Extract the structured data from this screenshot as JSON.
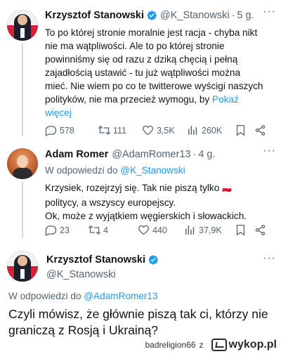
{
  "tweet1": {
    "name": "Krzysztof Stanowski",
    "handle": "@K_Stanowski",
    "time": "5 g.",
    "lines": [
      "To po której stronie moralnie jest racja - chyba nikt",
      "nie ma wątpliwości. Ale to po której stronie",
      "powinniśmy się od razu z dziką chęcią i pełną",
      "zajadłością ustawić - tu już wątpliwości można",
      "mieć. Nie wiem po co te twitterowe wyścigi naszych",
      "polityków, nie ma przecież wymogu, by"
    ],
    "show_more_a": "Pokaż",
    "show_more_b": "więcej",
    "replies": "578",
    "retweets": "111",
    "likes": "3,5K",
    "views": "260K"
  },
  "tweet2": {
    "name": "Adam Romer",
    "handle": "@AdamRomer13",
    "time": "4 g.",
    "reply_prefix": "W odpowiedzi do",
    "reply_handle": "@K_Stanowski",
    "lines": [
      "Krzysiek, rozejrzyj się. Tak nie piszą tylko",
      "politycy, a wszyscy europejscy.",
      "Ok, może z wyjątkiem węgierskich i słowackich."
    ],
    "flag_emoji": "🇵🇱",
    "replies": "23",
    "retweets": "4",
    "likes": "440",
    "views": "37,9K"
  },
  "tweet3": {
    "name": "Krzysztof Stanowski",
    "handle": "@K_Stanowski",
    "reply_prefix": "W odpowiedzi do",
    "reply_handle": "@AdamRomer13",
    "lines": [
      "Czyli mówisz, że głównie piszą tak ci, którzy nie",
      "graniczą z Rosją i Ukrainą?"
    ]
  },
  "footer": {
    "user": "badreligion66",
    "sep": "z",
    "site": "wykop.pl"
  },
  "colors": {
    "link": "#1d9bf0",
    "muted": "#536471",
    "verified": "#1d9bf0"
  }
}
